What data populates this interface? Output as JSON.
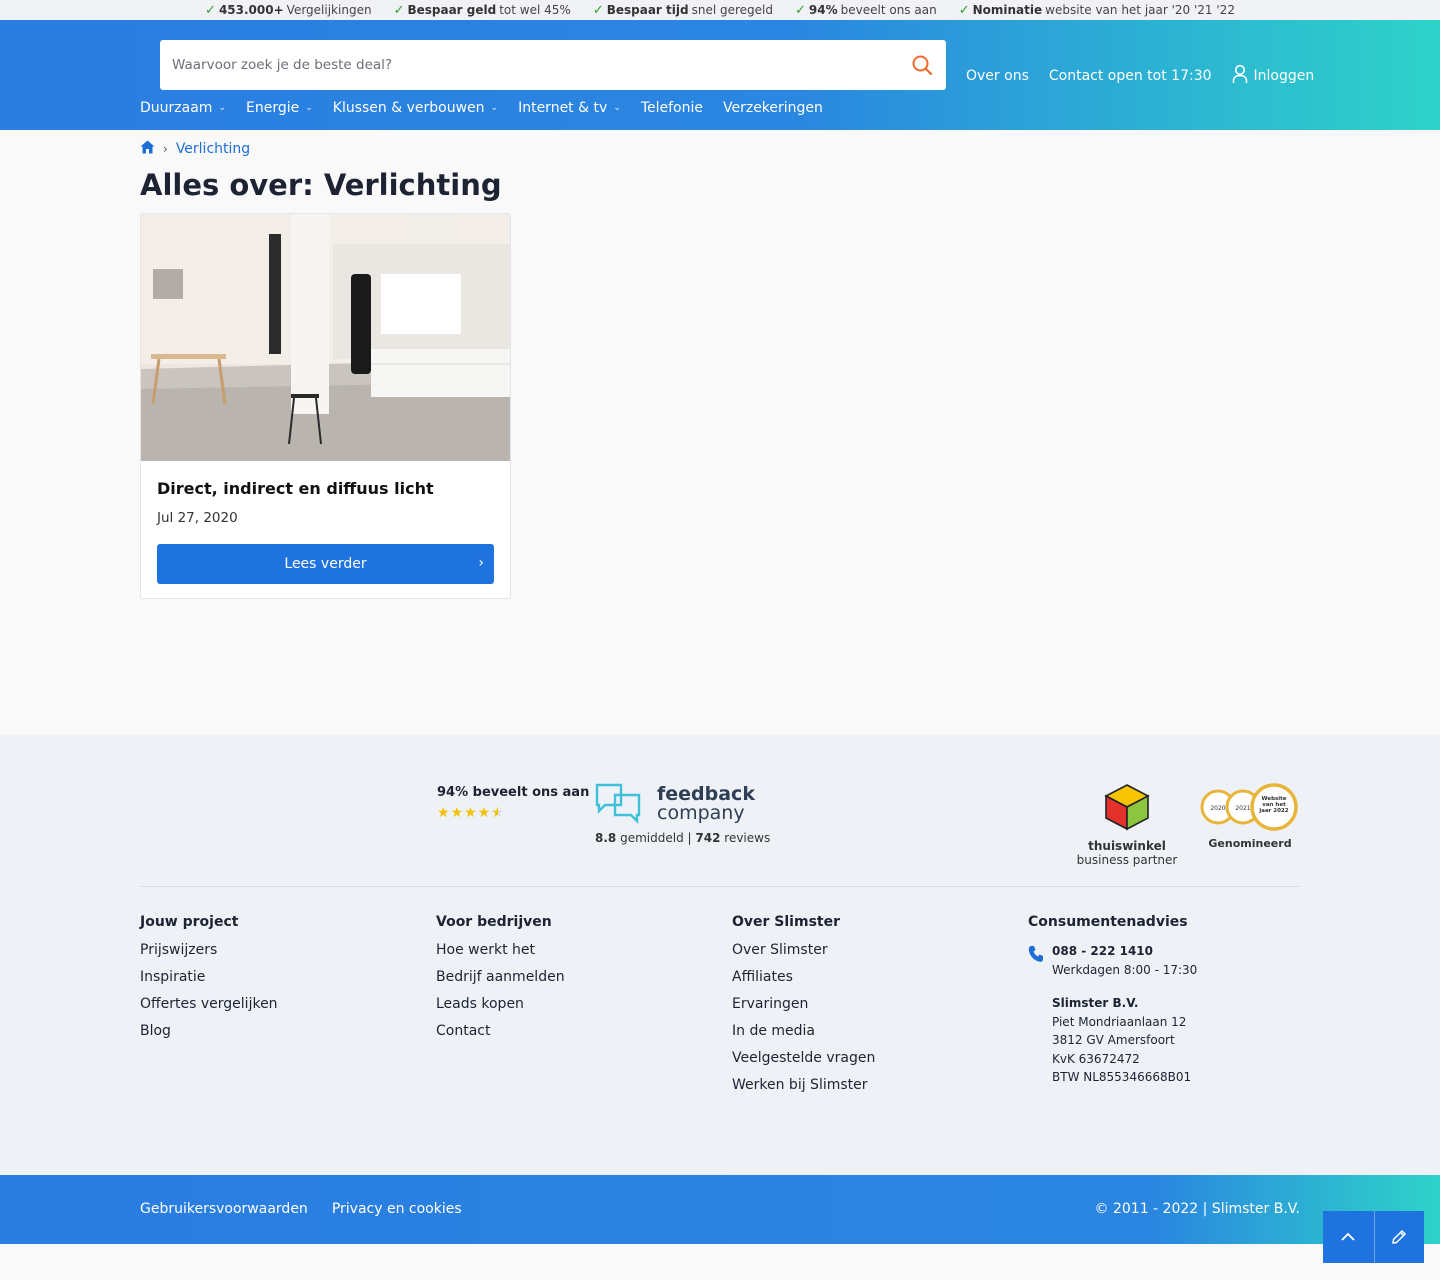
{
  "usp_bar": [
    {
      "bold": "453.000+",
      "text": " Vergelijkingen"
    },
    {
      "bold": "Bespaar geld",
      "text": " tot wel 45%"
    },
    {
      "bold": "Bespaar tijd",
      "text": " snel geregeld"
    },
    {
      "bold": "94%",
      "text": " beveelt ons aan"
    },
    {
      "bold": "Nominatie",
      "text": " website van het jaar '20 '21 '22"
    }
  ],
  "header": {
    "search_placeholder": "Waarvoor zoek je de beste deal?",
    "links": {
      "about": "Over ons",
      "contact": "Contact open tot 17:30",
      "login": "Inloggen"
    }
  },
  "mainnav": [
    {
      "label": "Duurzaam",
      "has_dropdown": true
    },
    {
      "label": "Energie",
      "has_dropdown": true
    },
    {
      "label": "Klussen & verbouwen",
      "has_dropdown": true
    },
    {
      "label": "Internet & tv",
      "has_dropdown": true
    },
    {
      "label": "Telefonie",
      "has_dropdown": false
    },
    {
      "label": "Verzekeringen",
      "has_dropdown": false
    }
  ],
  "breadcrumb": {
    "current": "Verlichting"
  },
  "page_title": "Alles over: Verlichting",
  "card": {
    "title": "Direct, indirect en diffuus licht",
    "date": "Jul 27, 2020",
    "button": "Lees verder"
  },
  "footer": {
    "trust_text": "94% beveelt ons aan",
    "rating_stars": 4.5,
    "feedback_logo": {
      "line1": "feedback",
      "line2": "company"
    },
    "feedback_avg": "8.8",
    "feedback_avg_label": "gemiddeld",
    "feedback_sep": "|",
    "feedback_reviews": "742",
    "feedback_reviews_label": "reviews",
    "thuiswinkel": {
      "line1": "thuiswinkel",
      "line2": "business partner"
    },
    "awards": {
      "years": [
        "2020",
        "2021",
        "Website van het jaar 2022"
      ],
      "label": "Genomineerd"
    },
    "columns": [
      {
        "heading": "Jouw project",
        "links": [
          "Prijswijzers",
          "Inspiratie",
          "Offertes vergelijken",
          "Blog"
        ]
      },
      {
        "heading": "Voor bedrijven",
        "links": [
          "Hoe werkt het",
          "Bedrijf aanmelden",
          "Leads kopen",
          "Contact"
        ]
      },
      {
        "heading": "Over Slimster",
        "links": [
          "Over Slimster",
          "Affiliates",
          "Ervaringen",
          "In de media",
          "Veelgestelde vragen",
          "Werken bij Slimster"
        ]
      }
    ],
    "consumer": {
      "heading": "Consumentenadvies",
      "phone": "088 - 222 1410",
      "hours": "Werkdagen 8:00 - 17:30",
      "company": "Slimster B.V.",
      "address1": "Piet Mondriaanlaan 12",
      "address2": "3812 GV Amersfoort",
      "kvk": "KvK 63672472",
      "btw": "BTW NL855346668B01"
    },
    "bottom": {
      "terms": "Gebruikersvoorwaarden",
      "privacy": "Privacy en cookies",
      "copyright": "© 2011 - 2022 | Slimster B.V."
    }
  },
  "colors": {
    "primary": "#1f73df",
    "accent_teal": "#2ed3c9",
    "search_icon": "#f06a2a",
    "check": "#2ca02c",
    "star": "#f2c200"
  }
}
